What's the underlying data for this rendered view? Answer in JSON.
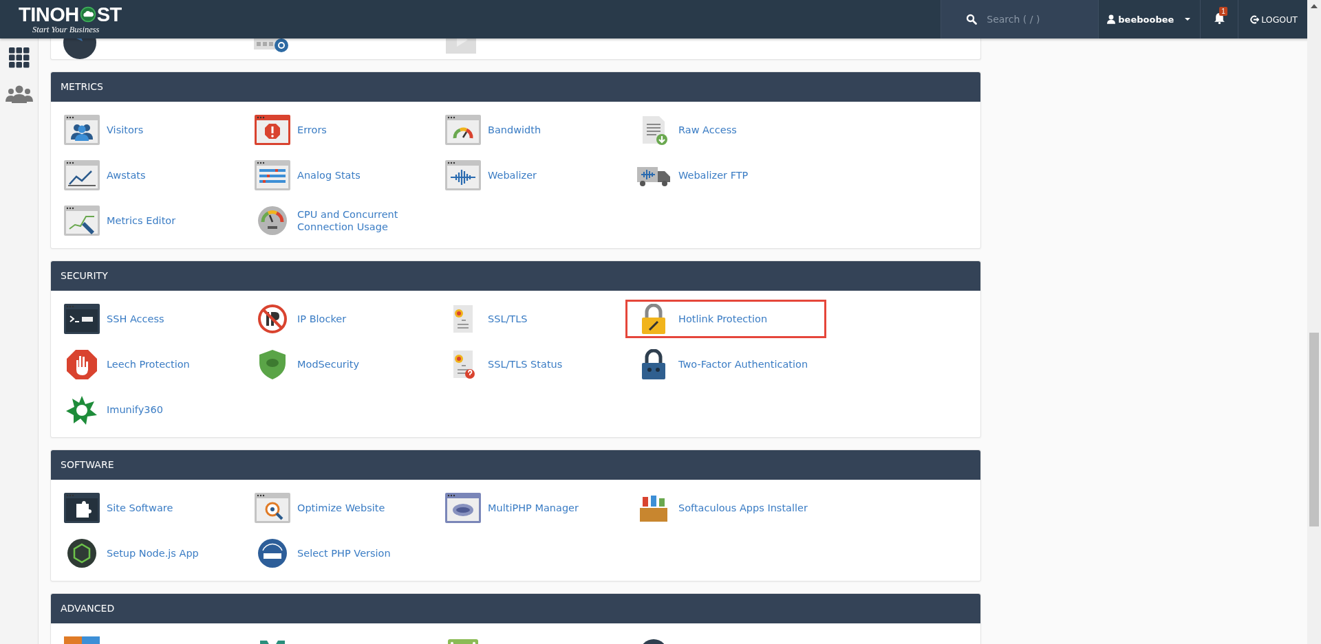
{
  "header": {
    "logo": {
      "left": "TINOH",
      "right": "ST",
      "tagline": "Start Your Business"
    },
    "search": {
      "placeholder": "Search ( / )"
    },
    "user": {
      "name": "beeboobee"
    },
    "notifications": {
      "count": "1"
    },
    "logout": {
      "label": "LOGOUT"
    }
  },
  "top_card": {
    "items": [
      {
        "kind": "globe"
      },
      {
        "kind": "email"
      },
      {
        "kind": "video"
      }
    ]
  },
  "sections": [
    {
      "title": "METRICS",
      "items": [
        {
          "label": "Visitors",
          "kind": "visitors",
          "highlighted": false
        },
        {
          "label": "Errors",
          "kind": "errors",
          "highlighted": false
        },
        {
          "label": "Bandwidth",
          "kind": "bandwidth",
          "highlighted": false
        },
        {
          "label": "Raw Access",
          "kind": "rawaccess",
          "highlighted": false
        },
        {
          "label": "Awstats",
          "kind": "awstats",
          "highlighted": false
        },
        {
          "label": "Analog Stats",
          "kind": "analog",
          "highlighted": false
        },
        {
          "label": "Webalizer",
          "kind": "webalizer",
          "highlighted": false
        },
        {
          "label": "Webalizer FTP",
          "kind": "truck",
          "highlighted": false
        },
        {
          "label": "Metrics Editor",
          "kind": "metricseditor",
          "highlighted": false
        },
        {
          "label": "CPU and Concurrent Connection Usage",
          "kind": "gauge",
          "highlighted": false
        }
      ]
    },
    {
      "title": "SECURITY",
      "items": [
        {
          "label": "SSH Access",
          "kind": "ssh",
          "highlighted": false
        },
        {
          "label": "IP Blocker",
          "kind": "ipblock",
          "highlighted": false
        },
        {
          "label": "SSL/TLS",
          "kind": "certificate",
          "highlighted": false
        },
        {
          "label": "Hotlink Protection",
          "kind": "lock",
          "highlighted": true
        },
        {
          "label": "Leech Protection",
          "kind": "hand",
          "highlighted": false
        },
        {
          "label": "ModSecurity",
          "kind": "shield",
          "highlighted": false
        },
        {
          "label": "SSL/TLS Status",
          "kind": "certquestion",
          "highlighted": false
        },
        {
          "label": "Two-Factor Authentication",
          "kind": "padlock",
          "highlighted": false
        },
        {
          "label": "Imunify360",
          "kind": "imunify",
          "highlighted": false
        }
      ]
    },
    {
      "title": "SOFTWARE",
      "items": [
        {
          "label": "Site Software",
          "kind": "puzzle",
          "highlighted": false
        },
        {
          "label": "Optimize Website",
          "kind": "optimize",
          "highlighted": false
        },
        {
          "label": "MultiPHP Manager",
          "kind": "php",
          "highlighted": false
        },
        {
          "label": "Softaculous Apps Installer",
          "kind": "softaculous",
          "highlighted": false
        },
        {
          "label": "Setup Node.js App",
          "kind": "nodejs",
          "highlighted": false
        },
        {
          "label": "Select PHP Version",
          "kind": "phpcircle",
          "highlighted": false
        }
      ]
    },
    {
      "title": "ADVANCED",
      "items": [
        {
          "kind": "colorful",
          "highlighted": false
        },
        {
          "kind": "teal",
          "highlighted": false
        },
        {
          "kind": "greenbar",
          "highlighted": false
        },
        {
          "kind": "ring",
          "highlighted": false
        }
      ]
    }
  ]
}
